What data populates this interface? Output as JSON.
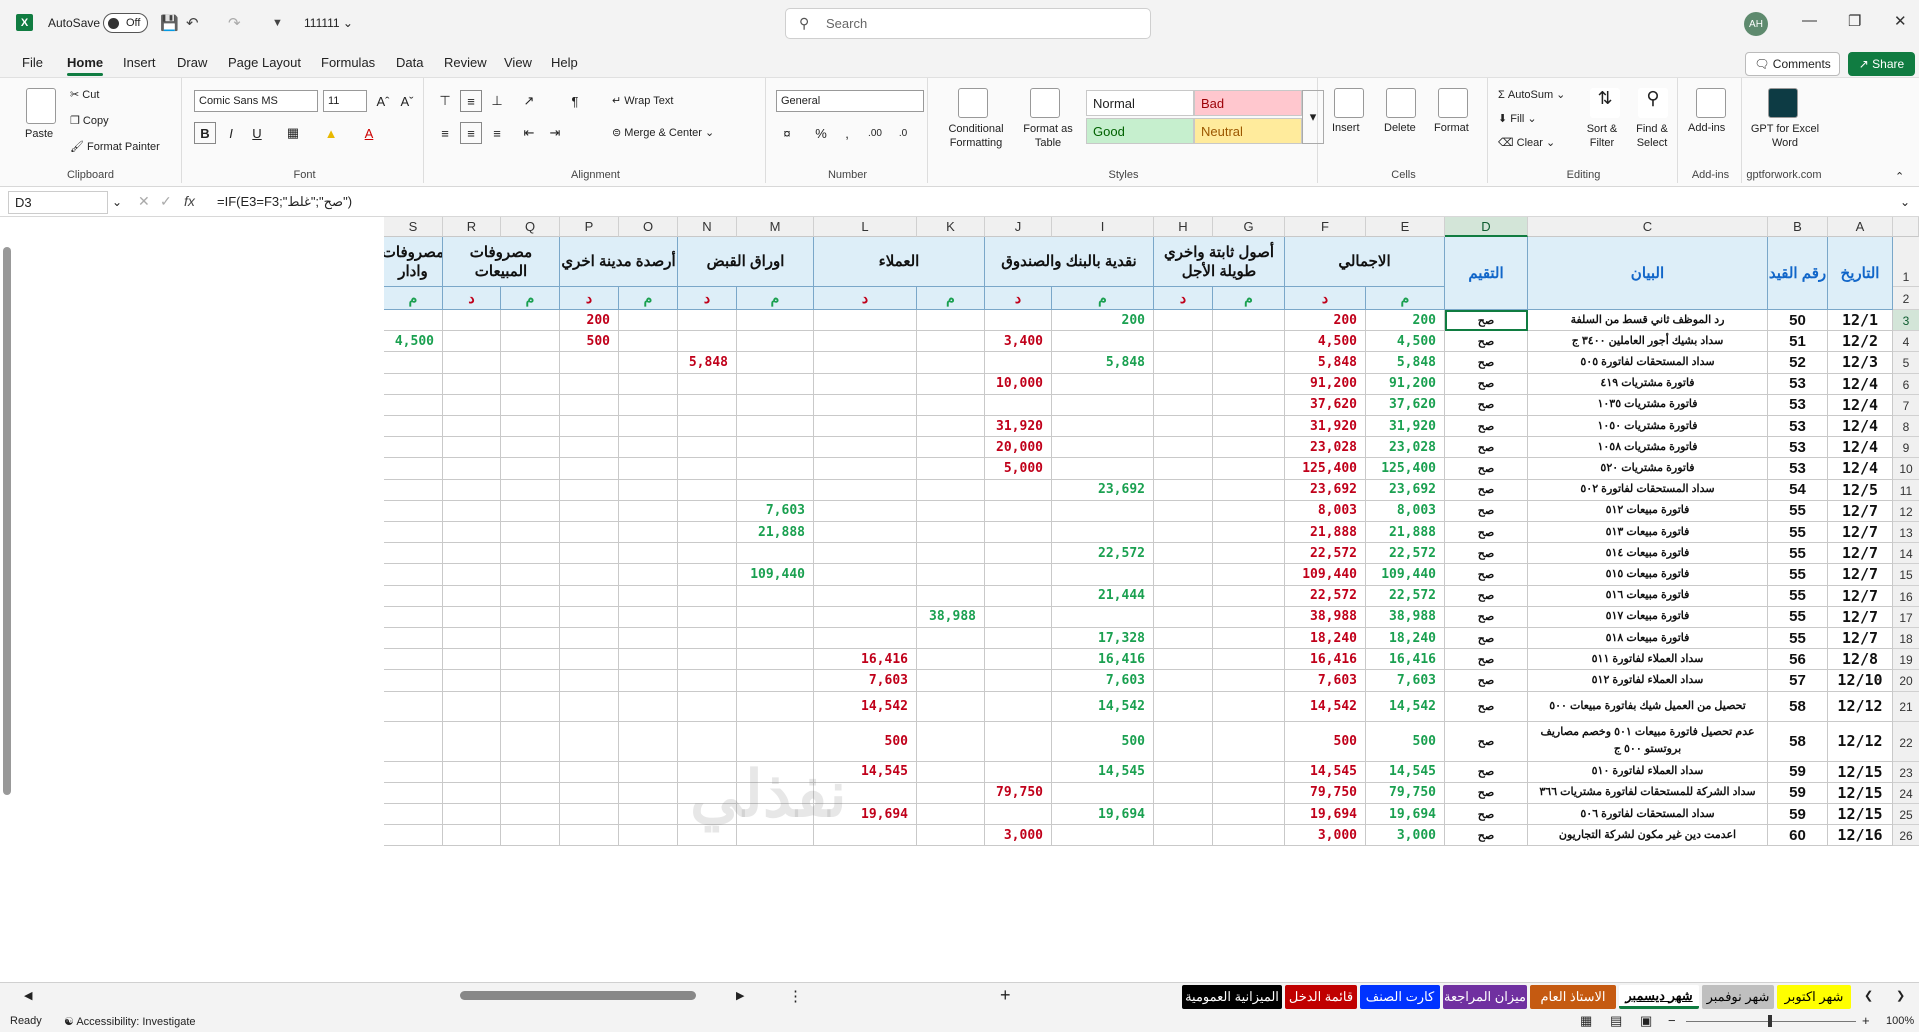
{
  "app": {
    "autosave_label": "AutoSave",
    "autosave_state": "Off",
    "doc_name": "111111",
    "search_placeholder": "Search",
    "avatar": "AH"
  },
  "menu": [
    "File",
    "Home",
    "Insert",
    "Draw",
    "Page Layout",
    "Formulas",
    "Data",
    "Review",
    "View",
    "Help"
  ],
  "actions": {
    "comments": "Comments",
    "share": "Share"
  },
  "ribbon": {
    "clipboard": {
      "paste": "Paste",
      "cut": "Cut",
      "copy": "Copy",
      "format_painter": "Format Painter",
      "label": "Clipboard"
    },
    "font": {
      "name": "Comic Sans MS",
      "size": "11",
      "label": "Font"
    },
    "alignment": {
      "wrap": "Wrap Text",
      "merge": "Merge & Center",
      "label": "Alignment"
    },
    "number": {
      "format": "General",
      "label": "Number"
    },
    "styles": {
      "cond": "Conditional Formatting",
      "table": "Format as Table",
      "normal": "Normal",
      "bad": "Bad",
      "good": "Good",
      "neutral": "Neutral",
      "label": "Styles"
    },
    "cells": {
      "insert": "Insert",
      "delete": "Delete",
      "format": "Format",
      "label": "Cells"
    },
    "editing": {
      "autosum": "AutoSum",
      "fill": "Fill",
      "clear": "Clear",
      "sort": "Sort & Filter",
      "find": "Find & Select",
      "label": "Editing"
    },
    "addins": {
      "addins": "Add-ins",
      "label": "Add-ins"
    },
    "gpt": {
      "name": "GPT for Excel Word",
      "label": "gptforwork.com"
    }
  },
  "formula_bar": {
    "cell": "D3",
    "formula": "=IF(E3=F3;\"صح\";\"غلط\")"
  },
  "columns": [
    {
      "id": "A",
      "w": 65
    },
    {
      "id": "B",
      "w": 60
    },
    {
      "id": "C",
      "w": 240
    },
    {
      "id": "D",
      "w": 83
    },
    {
      "id": "E",
      "w": 79
    },
    {
      "id": "F",
      "w": 81
    },
    {
      "id": "G",
      "w": 72
    },
    {
      "id": "H",
      "w": 59
    },
    {
      "id": "I",
      "w": 102
    },
    {
      "id": "J",
      "w": 67
    },
    {
      "id": "K",
      "w": 68
    },
    {
      "id": "L",
      "w": 103
    },
    {
      "id": "M",
      "w": 77
    },
    {
      "id": "N",
      "w": 59
    },
    {
      "id": "O",
      "w": 59
    },
    {
      "id": "P",
      "w": 59
    },
    {
      "id": "Q",
      "w": 59
    },
    {
      "id": "R",
      "w": 58
    },
    {
      "id": "S",
      "w": 59
    }
  ],
  "header_groups": [
    {
      "cols": [
        "A"
      ],
      "text": "التاريخ",
      "blue": true
    },
    {
      "cols": [
        "B"
      ],
      "text": "رقم القيد",
      "blue": true
    },
    {
      "cols": [
        "C"
      ],
      "text": "البيان",
      "blue": true
    },
    {
      "cols": [
        "D"
      ],
      "text": "التقيم",
      "blue": true
    },
    {
      "cols": [
        "E",
        "F"
      ],
      "text": "الاجمالي"
    },
    {
      "cols": [
        "G",
        "H"
      ],
      "text": "أصول ثابتة واخري طويلة الأجل"
    },
    {
      "cols": [
        "I",
        "J"
      ],
      "text": "نقدية بالبنك والصندوق"
    },
    {
      "cols": [
        "K",
        "L"
      ],
      "text": "العملاء"
    },
    {
      "cols": [
        "M",
        "N"
      ],
      "text": "اوراق القبض"
    },
    {
      "cols": [
        "O",
        "P"
      ],
      "text": "أرصدة مدينة اخري"
    },
    {
      "cols": [
        "Q",
        "R"
      ],
      "text": "مصروفات المبيعات"
    },
    {
      "cols": [
        "S"
      ],
      "text": "مصروفات وادار"
    }
  ],
  "sub_labels": {
    "m": "م",
    "d": "د"
  },
  "rows": [
    {
      "n": 3,
      "a": "12/1",
      "b": "50",
      "c": "رد الموظف ثاني قسط من السلفة",
      "d": "صح",
      "v": {
        "E": "200",
        "F": "200",
        "I": "200",
        "P": "200"
      }
    },
    {
      "n": 4,
      "a": "12/2",
      "b": "51",
      "c": "سداد بشيك أجور العاملين ٣٤٠٠ ج",
      "d": "صح",
      "v": {
        "E": "4,500",
        "F": "4,500",
        "J": "3,400",
        "P": "500",
        "S": "4,500"
      }
    },
    {
      "n": 5,
      "a": "12/3",
      "b": "52",
      "c": "سداد المستحقات لفاتورة ٥٠٥",
      "d": "صح",
      "v": {
        "E": "5,848",
        "F": "5,848",
        "I": "5,848",
        "N": "5,848"
      }
    },
    {
      "n": 6,
      "a": "12/4",
      "b": "53",
      "c": "فاتورة مشتريات ٤١٩",
      "d": "صح",
      "v": {
        "E": "91,200",
        "F": "91,200",
        "J": "10,000"
      }
    },
    {
      "n": 7,
      "a": "12/4",
      "b": "53",
      "c": "فاتورة مشتريات ١٠٣٥",
      "d": "صح",
      "v": {
        "E": "37,620",
        "F": "37,620"
      }
    },
    {
      "n": 8,
      "a": "12/4",
      "b": "53",
      "c": "فاتورة مشتريات ١٠٥٠",
      "d": "صح",
      "v": {
        "E": "31,920",
        "F": "31,920",
        "J": "31,920"
      }
    },
    {
      "n": 9,
      "a": "12/4",
      "b": "53",
      "c": "فاتورة مشتريات ١٠٥٨",
      "d": "صح",
      "v": {
        "E": "23,028",
        "F": "23,028",
        "J": "20,000"
      }
    },
    {
      "n": 10,
      "a": "12/4",
      "b": "53",
      "c": "فاتورة مشتريات ٥٢٠",
      "d": "صح",
      "v": {
        "E": "125,400",
        "F": "125,400",
        "J": "5,000"
      }
    },
    {
      "n": 11,
      "a": "12/5",
      "b": "54",
      "c": "سداد المستحقات لفاتورة ٥٠٢",
      "d": "صح",
      "v": {
        "E": "23,692",
        "F": "23,692",
        "I": "23,692"
      }
    },
    {
      "n": 12,
      "a": "12/7",
      "b": "55",
      "c": "فاتورة مبيعات ٥١٢",
      "d": "صح",
      "v": {
        "E": "8,003",
        "F": "8,003",
        "M": "7,603"
      }
    },
    {
      "n": 13,
      "a": "12/7",
      "b": "55",
      "c": "فاتورة مبيعات ٥١٣",
      "d": "صح",
      "v": {
        "E": "21,888",
        "F": "21,888",
        "M": "21,888"
      }
    },
    {
      "n": 14,
      "a": "12/7",
      "b": "55",
      "c": "فاتورة مبيعات ٥١٤",
      "d": "صح",
      "v": {
        "E": "22,572",
        "F": "22,572",
        "I": "22,572"
      }
    },
    {
      "n": 15,
      "a": "12/7",
      "b": "55",
      "c": "فاتورة مبيعات ٥١٥",
      "d": "صح",
      "v": {
        "E": "109,440",
        "F": "109,440",
        "M": "109,440"
      }
    },
    {
      "n": 16,
      "a": "12/7",
      "b": "55",
      "c": "فاتورة مبيعات ٥١٦",
      "d": "صح",
      "v": {
        "E": "22,572",
        "F": "22,572",
        "I": "21,444"
      }
    },
    {
      "n": 17,
      "a": "12/7",
      "b": "55",
      "c": "فاتورة مبيعات ٥١٧",
      "d": "صح",
      "v": {
        "E": "38,988",
        "F": "38,988",
        "K": "38,988"
      }
    },
    {
      "n": 18,
      "a": "12/7",
      "b": "55",
      "c": "فاتورة مبيعات ٥١٨",
      "d": "صح",
      "v": {
        "E": "18,240",
        "F": "18,240",
        "I": "17,328"
      }
    },
    {
      "n": 19,
      "a": "12/8",
      "b": "56",
      "c": "سداد العملاء لفاتورة ٥١١",
      "d": "صح",
      "v": {
        "E": "16,416",
        "F": "16,416",
        "I": "16,416",
        "L": "16,416"
      }
    },
    {
      "n": 20,
      "a": "12/10",
      "b": "57",
      "c": "سداد العملاء لفاتورة ٥١٢",
      "d": "صح",
      "v": {
        "E": "7,603",
        "F": "7,603",
        "I": "7,603",
        "L": "7,603"
      }
    },
    {
      "n": 21,
      "a": "12/12",
      "b": "58",
      "c": "تحصيل من العميل شيك بفاتورة مبيعات ٥٠٠",
      "d": "صح",
      "v": {
        "E": "14,542",
        "F": "14,542",
        "I": "14,542",
        "L": "14,542"
      }
    },
    {
      "n": 22,
      "a": "12/12",
      "b": "58",
      "c": "عدم تحصيل فاتورة مبيعات ٥٠١ وخصم مصاريف بروتستو ٥٠٠ ج",
      "d": "صح",
      "v": {
        "E": "500",
        "F": "500",
        "I": "500",
        "L": "500"
      }
    },
    {
      "n": 23,
      "a": "12/15",
      "b": "59",
      "c": "سداد العملاء لفاتورة ٥١٠",
      "d": "صح",
      "v": {
        "E": "14,545",
        "F": "14,545",
        "I": "14,545",
        "L": "14,545"
      }
    },
    {
      "n": 24,
      "a": "12/15",
      "b": "59",
      "c": "سداد الشركة للمستحقات لفاتورة مشتريات ٣٦٦",
      "d": "صح",
      "v": {
        "E": "79,750",
        "F": "79,750",
        "J": "79,750"
      }
    },
    {
      "n": 25,
      "a": "12/15",
      "b": "59",
      "c": "سداد المستحقات لفاتورة ٥٠٦",
      "d": "صح",
      "v": {
        "E": "19,694",
        "F": "19,694",
        "I": "19,694",
        "L": "19,694"
      }
    },
    {
      "n": 26,
      "a": "12/16",
      "b": "60",
      "c": "اعدمت دين غير مكون لشركة التجاريون",
      "d": "صح",
      "v": {
        "E": "3,000",
        "F": "3,000",
        "J": "3,000"
      }
    }
  ],
  "sheets": [
    {
      "name": "شهر اكتوبر",
      "bg": "#ffff00",
      "fg": "#000"
    },
    {
      "name": "شهر نوفمبر",
      "bg": "#bfbfbf",
      "fg": "#000"
    },
    {
      "name": "شهر ديسمبر",
      "bg": "#ffffff",
      "fg": "#000",
      "active": true
    },
    {
      "name": "الاستاذ العام",
      "bg": "#c55a11",
      "fg": "#fff"
    },
    {
      "name": "ميزان المراجعة",
      "bg": "#7030a0",
      "fg": "#fff"
    },
    {
      "name": "كارت الصنف",
      "bg": "#0033ff",
      "fg": "#fff"
    },
    {
      "name": "قائمة الدخل",
      "bg": "#c00000",
      "fg": "#fff"
    },
    {
      "name": "الميزانية العمومية",
      "bg": "#000000",
      "fg": "#fff"
    }
  ],
  "status": {
    "ready": "Ready",
    "accessibility": "Accessibility: Investigate",
    "zoom": "100%"
  },
  "watermark": "نفذلي"
}
